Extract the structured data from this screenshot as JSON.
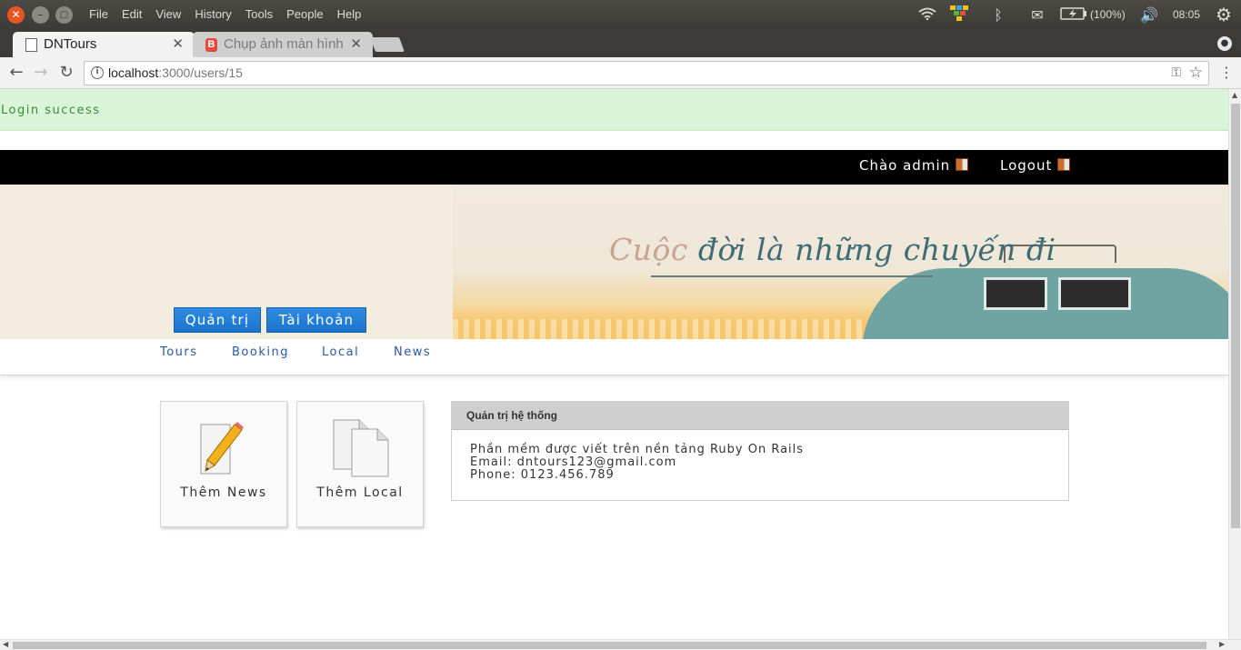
{
  "os": {
    "menu": [
      "File",
      "Edit",
      "View",
      "History",
      "Tools",
      "People",
      "Help"
    ],
    "battery_text": "(100%)",
    "clock": "08:05"
  },
  "browser": {
    "tabs": [
      {
        "title": "DNTours",
        "active": true
      },
      {
        "title": "Chụp ảnh màn hình",
        "active": false
      }
    ],
    "url_host": "localhost",
    "url_path": ":3000/users/15"
  },
  "page": {
    "flash": "Login success",
    "topbar": {
      "greeting": "Chào admin",
      "logout": "Logout"
    },
    "banner": {
      "tagline_accent": "Cuộc",
      "tagline_rest": " đời là những chuyến đi"
    },
    "tab_buttons": [
      "Quản trị",
      "Tài khoản"
    ],
    "subnav": [
      "Tours",
      "Booking",
      "Local",
      "News"
    ],
    "tiles": [
      {
        "label": "Thêm News",
        "icon": "pencil-icon"
      },
      {
        "label": "Thêm Local",
        "icon": "documents-icon"
      }
    ],
    "panel": {
      "title": "Quản trị hệ thống",
      "lines": [
        "Phần mềm được viết trên nền tảng Ruby On Rails",
        "Email: dntours123@gmail.com",
        "Phone: 0123.456.789"
      ]
    }
  },
  "colors": {
    "ubuntu_orange": "#e95420",
    "flash_bg": "#d9f4d8",
    "primary_blue": "#1a74cf",
    "link_blue": "#2a57a5"
  }
}
